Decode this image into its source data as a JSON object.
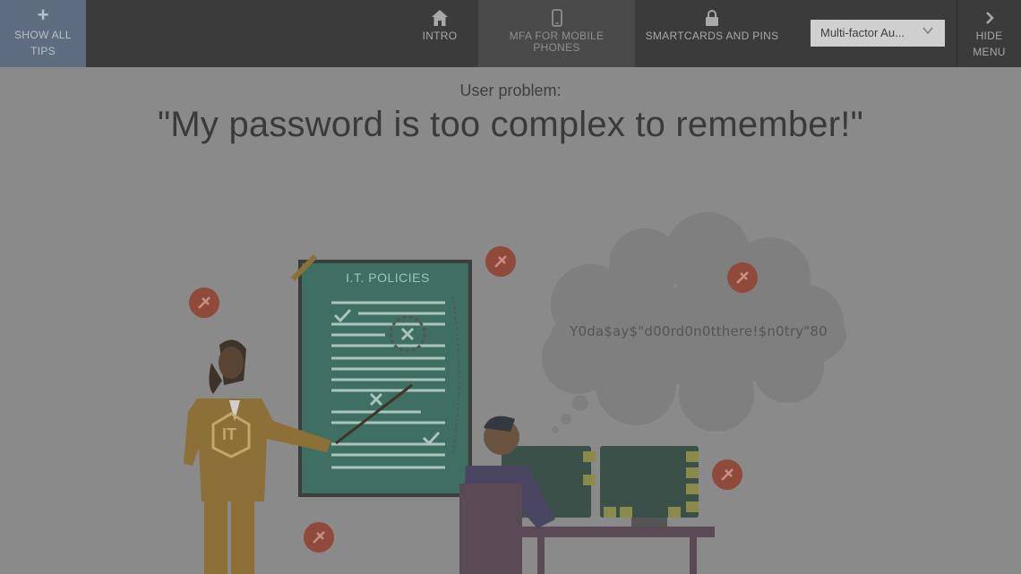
{
  "toolbar": {
    "show_all_label": "SHOW ALL TIPS",
    "hide_menu_label": "HIDE MENU"
  },
  "nav": {
    "intro": "INTRO",
    "mfa": "MFA FOR MOBILE PHONES",
    "smartcards": "SMARTCARDS AND PINS"
  },
  "select": {
    "value": "Multi-factor Au..."
  },
  "content": {
    "label": "User problem:",
    "quote": "\"My password is too complex to remember!\""
  },
  "illustration": {
    "board_title": "I.T. POLICIES",
    "badge": "IT",
    "thought_password": "Y0da$ay$\"d00rd0n0tthere!$n0try\"80"
  },
  "icons": {
    "plus": "plus-icon",
    "home": "home-icon",
    "phone": "mobile-phone-icon",
    "lock": "lock-icon",
    "chevron_down": "chevron-down-icon",
    "chevron_right": "chevron-right-icon",
    "pin": "pin-icon"
  },
  "colors": {
    "topbar": "#3b3b3b",
    "show_all_bg": "#5d6d7f",
    "page_bg": "#8a8a8a",
    "board": "#3f7a6a",
    "pin": "#9a4a3a",
    "presenter_suit": "#8c7038"
  }
}
